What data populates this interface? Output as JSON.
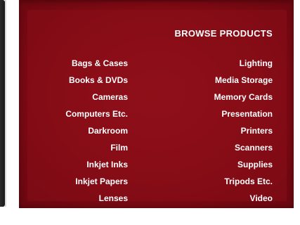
{
  "browse": {
    "title": "BROWSE PRODUCTS",
    "left_column": [
      {
        "label": "Bags & Cases"
      },
      {
        "label": "Books & DVDs"
      },
      {
        "label": "Cameras"
      },
      {
        "label": "Computers Etc."
      },
      {
        "label": "Darkroom"
      },
      {
        "label": "Film"
      },
      {
        "label": "Inkjet Inks"
      },
      {
        "label": "Inkjet Papers"
      },
      {
        "label": "Lenses"
      }
    ],
    "right_column": [
      {
        "label": "Lighting"
      },
      {
        "label": "Media Storage"
      },
      {
        "label": "Memory Cards"
      },
      {
        "label": "Presentation"
      },
      {
        "label": "Printers"
      },
      {
        "label": "Scanners"
      },
      {
        "label": "Supplies"
      },
      {
        "label": "Tripods Etc."
      },
      {
        "label": "Video"
      }
    ]
  },
  "colors": {
    "panel_background": "#7c0a12",
    "text": "#ffffff"
  }
}
